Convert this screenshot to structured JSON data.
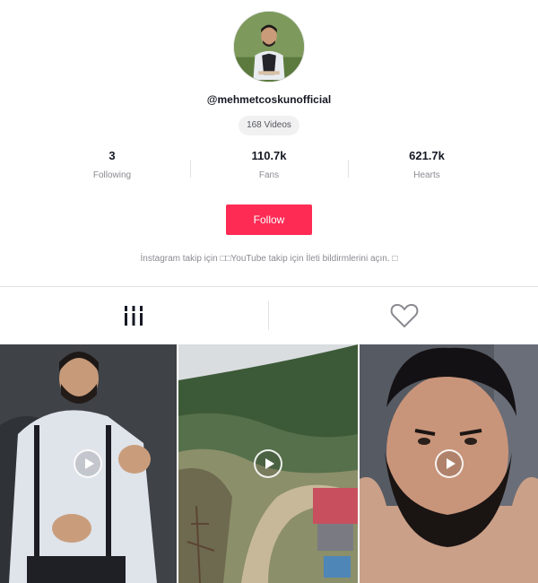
{
  "profile": {
    "avatar_icon": "profile-photo",
    "username": "@mehmetcoskunofficial",
    "videos_count": "168 Videos",
    "stats": [
      {
        "value": "3",
        "label": "Following"
      },
      {
        "value": "110.7k",
        "label": "Fans"
      },
      {
        "value": "621.7k",
        "label": "Hearts"
      }
    ],
    "follow_label": "Follow",
    "bio": "İnstagram takip için □□YouTube takip için İleti bildirmlerini açın. □"
  },
  "tabs": [
    {
      "icon": "videos-grid-icon"
    },
    {
      "icon": "heart-icon"
    }
  ],
  "videos": [
    {
      "icon": "play-icon"
    },
    {
      "icon": "play-icon"
    },
    {
      "icon": "play-icon"
    }
  ],
  "colors": {
    "accent": "#fe2c55",
    "text_primary": "#161823",
    "text_secondary": "#8a8b91"
  }
}
